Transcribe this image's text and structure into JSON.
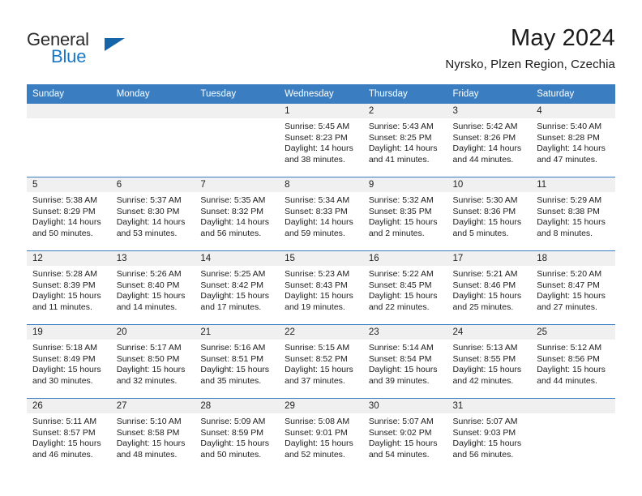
{
  "brand": {
    "word_primary": "General",
    "word_secondary": "Blue",
    "triangle_icon": "triangle-logo-icon",
    "color_primary": "#2b2b2b",
    "color_secondary": "#1878c8",
    "color_triangle": "#1565a8"
  },
  "header": {
    "month_title": "May 2024",
    "location": "Nyrsko, Plzen Region, Czechia"
  },
  "theme": {
    "header_blue": "#3a7ec1",
    "daynum_band": "#f0f0f0",
    "cell_bg": "#ffffff",
    "text": "#1c1c1c"
  },
  "calendar": {
    "weekday_headers": [
      "Sunday",
      "Monday",
      "Tuesday",
      "Wednesday",
      "Thursday",
      "Friday",
      "Saturday"
    ],
    "weeks": [
      [
        {
          "day": "",
          "empty": true,
          "sunrise": "",
          "sunset": "",
          "daylight_1": "",
          "daylight_2": ""
        },
        {
          "day": "",
          "empty": true,
          "sunrise": "",
          "sunset": "",
          "daylight_1": "",
          "daylight_2": ""
        },
        {
          "day": "",
          "empty": true,
          "sunrise": "",
          "sunset": "",
          "daylight_1": "",
          "daylight_2": ""
        },
        {
          "day": "1",
          "empty": false,
          "sunrise": "Sunrise: 5:45 AM",
          "sunset": "Sunset: 8:23 PM",
          "daylight_1": "Daylight: 14 hours",
          "daylight_2": "and 38 minutes."
        },
        {
          "day": "2",
          "empty": false,
          "sunrise": "Sunrise: 5:43 AM",
          "sunset": "Sunset: 8:25 PM",
          "daylight_1": "Daylight: 14 hours",
          "daylight_2": "and 41 minutes."
        },
        {
          "day": "3",
          "empty": false,
          "sunrise": "Sunrise: 5:42 AM",
          "sunset": "Sunset: 8:26 PM",
          "daylight_1": "Daylight: 14 hours",
          "daylight_2": "and 44 minutes."
        },
        {
          "day": "4",
          "empty": false,
          "sunrise": "Sunrise: 5:40 AM",
          "sunset": "Sunset: 8:28 PM",
          "daylight_1": "Daylight: 14 hours",
          "daylight_2": "and 47 minutes."
        }
      ],
      [
        {
          "day": "5",
          "empty": false,
          "sunrise": "Sunrise: 5:38 AM",
          "sunset": "Sunset: 8:29 PM",
          "daylight_1": "Daylight: 14 hours",
          "daylight_2": "and 50 minutes."
        },
        {
          "day": "6",
          "empty": false,
          "sunrise": "Sunrise: 5:37 AM",
          "sunset": "Sunset: 8:30 PM",
          "daylight_1": "Daylight: 14 hours",
          "daylight_2": "and 53 minutes."
        },
        {
          "day": "7",
          "empty": false,
          "sunrise": "Sunrise: 5:35 AM",
          "sunset": "Sunset: 8:32 PM",
          "daylight_1": "Daylight: 14 hours",
          "daylight_2": "and 56 minutes."
        },
        {
          "day": "8",
          "empty": false,
          "sunrise": "Sunrise: 5:34 AM",
          "sunset": "Sunset: 8:33 PM",
          "daylight_1": "Daylight: 14 hours",
          "daylight_2": "and 59 minutes."
        },
        {
          "day": "9",
          "empty": false,
          "sunrise": "Sunrise: 5:32 AM",
          "sunset": "Sunset: 8:35 PM",
          "daylight_1": "Daylight: 15 hours",
          "daylight_2": "and 2 minutes."
        },
        {
          "day": "10",
          "empty": false,
          "sunrise": "Sunrise: 5:30 AM",
          "sunset": "Sunset: 8:36 PM",
          "daylight_1": "Daylight: 15 hours",
          "daylight_2": "and 5 minutes."
        },
        {
          "day": "11",
          "empty": false,
          "sunrise": "Sunrise: 5:29 AM",
          "sunset": "Sunset: 8:38 PM",
          "daylight_1": "Daylight: 15 hours",
          "daylight_2": "and 8 minutes."
        }
      ],
      [
        {
          "day": "12",
          "empty": false,
          "sunrise": "Sunrise: 5:28 AM",
          "sunset": "Sunset: 8:39 PM",
          "daylight_1": "Daylight: 15 hours",
          "daylight_2": "and 11 minutes."
        },
        {
          "day": "13",
          "empty": false,
          "sunrise": "Sunrise: 5:26 AM",
          "sunset": "Sunset: 8:40 PM",
          "daylight_1": "Daylight: 15 hours",
          "daylight_2": "and 14 minutes."
        },
        {
          "day": "14",
          "empty": false,
          "sunrise": "Sunrise: 5:25 AM",
          "sunset": "Sunset: 8:42 PM",
          "daylight_1": "Daylight: 15 hours",
          "daylight_2": "and 17 minutes."
        },
        {
          "day": "15",
          "empty": false,
          "sunrise": "Sunrise: 5:23 AM",
          "sunset": "Sunset: 8:43 PM",
          "daylight_1": "Daylight: 15 hours",
          "daylight_2": "and 19 minutes."
        },
        {
          "day": "16",
          "empty": false,
          "sunrise": "Sunrise: 5:22 AM",
          "sunset": "Sunset: 8:45 PM",
          "daylight_1": "Daylight: 15 hours",
          "daylight_2": "and 22 minutes."
        },
        {
          "day": "17",
          "empty": false,
          "sunrise": "Sunrise: 5:21 AM",
          "sunset": "Sunset: 8:46 PM",
          "daylight_1": "Daylight: 15 hours",
          "daylight_2": "and 25 minutes."
        },
        {
          "day": "18",
          "empty": false,
          "sunrise": "Sunrise: 5:20 AM",
          "sunset": "Sunset: 8:47 PM",
          "daylight_1": "Daylight: 15 hours",
          "daylight_2": "and 27 minutes."
        }
      ],
      [
        {
          "day": "19",
          "empty": false,
          "sunrise": "Sunrise: 5:18 AM",
          "sunset": "Sunset: 8:49 PM",
          "daylight_1": "Daylight: 15 hours",
          "daylight_2": "and 30 minutes."
        },
        {
          "day": "20",
          "empty": false,
          "sunrise": "Sunrise: 5:17 AM",
          "sunset": "Sunset: 8:50 PM",
          "daylight_1": "Daylight: 15 hours",
          "daylight_2": "and 32 minutes."
        },
        {
          "day": "21",
          "empty": false,
          "sunrise": "Sunrise: 5:16 AM",
          "sunset": "Sunset: 8:51 PM",
          "daylight_1": "Daylight: 15 hours",
          "daylight_2": "and 35 minutes."
        },
        {
          "day": "22",
          "empty": false,
          "sunrise": "Sunrise: 5:15 AM",
          "sunset": "Sunset: 8:52 PM",
          "daylight_1": "Daylight: 15 hours",
          "daylight_2": "and 37 minutes."
        },
        {
          "day": "23",
          "empty": false,
          "sunrise": "Sunrise: 5:14 AM",
          "sunset": "Sunset: 8:54 PM",
          "daylight_1": "Daylight: 15 hours",
          "daylight_2": "and 39 minutes."
        },
        {
          "day": "24",
          "empty": false,
          "sunrise": "Sunrise: 5:13 AM",
          "sunset": "Sunset: 8:55 PM",
          "daylight_1": "Daylight: 15 hours",
          "daylight_2": "and 42 minutes."
        },
        {
          "day": "25",
          "empty": false,
          "sunrise": "Sunrise: 5:12 AM",
          "sunset": "Sunset: 8:56 PM",
          "daylight_1": "Daylight: 15 hours",
          "daylight_2": "and 44 minutes."
        }
      ],
      [
        {
          "day": "26",
          "empty": false,
          "sunrise": "Sunrise: 5:11 AM",
          "sunset": "Sunset: 8:57 PM",
          "daylight_1": "Daylight: 15 hours",
          "daylight_2": "and 46 minutes."
        },
        {
          "day": "27",
          "empty": false,
          "sunrise": "Sunrise: 5:10 AM",
          "sunset": "Sunset: 8:58 PM",
          "daylight_1": "Daylight: 15 hours",
          "daylight_2": "and 48 minutes."
        },
        {
          "day": "28",
          "empty": false,
          "sunrise": "Sunrise: 5:09 AM",
          "sunset": "Sunset: 8:59 PM",
          "daylight_1": "Daylight: 15 hours",
          "daylight_2": "and 50 minutes."
        },
        {
          "day": "29",
          "empty": false,
          "sunrise": "Sunrise: 5:08 AM",
          "sunset": "Sunset: 9:01 PM",
          "daylight_1": "Daylight: 15 hours",
          "daylight_2": "and 52 minutes."
        },
        {
          "day": "30",
          "empty": false,
          "sunrise": "Sunrise: 5:07 AM",
          "sunset": "Sunset: 9:02 PM",
          "daylight_1": "Daylight: 15 hours",
          "daylight_2": "and 54 minutes."
        },
        {
          "day": "31",
          "empty": false,
          "sunrise": "Sunrise: 5:07 AM",
          "sunset": "Sunset: 9:03 PM",
          "daylight_1": "Daylight: 15 hours",
          "daylight_2": "and 56 minutes."
        },
        {
          "day": "",
          "empty": true,
          "sunrise": "",
          "sunset": "",
          "daylight_1": "",
          "daylight_2": ""
        }
      ]
    ]
  }
}
